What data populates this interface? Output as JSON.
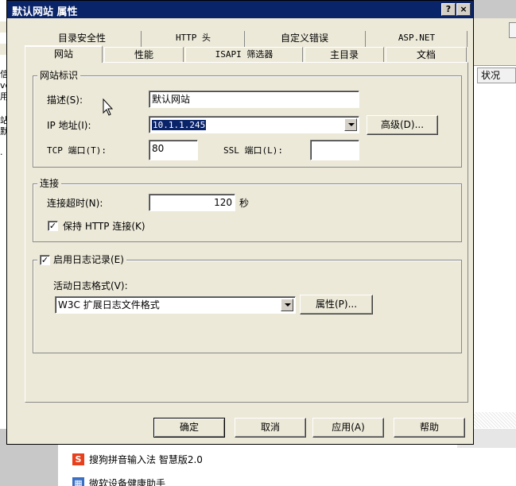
{
  "background": {
    "left_fragments": [
      "信",
      "vc",
      "用",
      "站",
      "默",
      "."
    ],
    "right_column_header": "状况",
    "taskbar_items": [
      {
        "label": "搜狗拼音输入法 智慧版2.0",
        "icon": "sogou-icon"
      },
      {
        "label": "微软设备健康助手",
        "icon": "app-icon"
      }
    ]
  },
  "dialog": {
    "title": "默认网站 属性",
    "help_glyph": "?",
    "close_glyph": "×",
    "tabs_row1": [
      "目录安全性",
      "HTTP 头",
      "自定义错误",
      "ASP.NET"
    ],
    "tabs_row2": [
      "网站",
      "性能",
      "ISAPI 筛选器",
      "主目录",
      "文档"
    ],
    "active_tab": "网站"
  },
  "site_id": {
    "group_label": "网站标识",
    "desc_label": "描述(S):",
    "desc_value": "默认网站",
    "ip_label": "IP 地址(I):",
    "ip_value": "10.1.1.245",
    "advanced_button": "高级(D)...",
    "tcp_label": "TCP 端口(T):",
    "tcp_value": "80",
    "ssl_label": "SSL 端口(L):",
    "ssl_value": ""
  },
  "connection": {
    "group_label": "连接",
    "timeout_label": "连接超时(N):",
    "timeout_value": "120",
    "timeout_unit": "秒",
    "keepalive_label": "保持 HTTP 连接(K)",
    "keepalive_checked": true
  },
  "logging": {
    "enable_label": "启用日志记录(E)",
    "enable_checked": true,
    "format_label": "活动日志格式(V):",
    "format_value": "W3C 扩展日志文件格式",
    "properties_button": "属性(P)..."
  },
  "buttons": {
    "ok": "确定",
    "cancel": "取消",
    "apply": "应用(A)",
    "help": "帮助"
  }
}
